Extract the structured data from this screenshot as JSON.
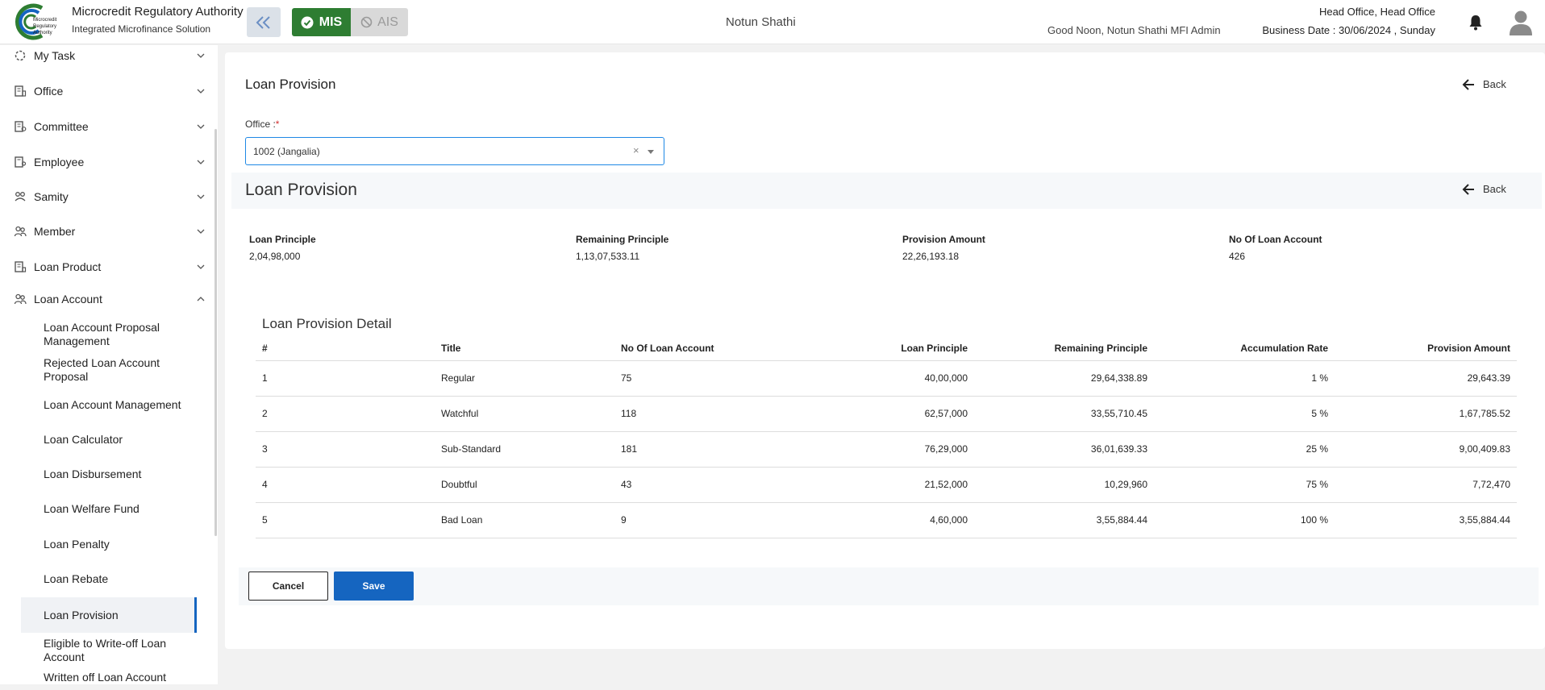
{
  "header": {
    "org_title": "Microcredit Regulatory Authority",
    "org_subtitle": "Integrated Microfinance Solution",
    "logo_text": "Microcredit Regulatory Authority",
    "mode_mis": "MIS",
    "mode_ais": "AIS",
    "brand_center": "Notun Shathi",
    "greeting": "Good Noon, Notun Shathi MFI Admin",
    "office": "Head Office, Head Office",
    "business_date": "Business Date : 30/06/2024 , Sunday",
    "accent_green": "#2e7d32",
    "accent_blue": "#1565c0"
  },
  "sidebar": {
    "items": [
      {
        "label": "My Task",
        "icon": "task-icon"
      },
      {
        "label": "Office",
        "icon": "office-icon"
      },
      {
        "label": "Committee",
        "icon": "committee-icon"
      },
      {
        "label": "Employee",
        "icon": "employee-icon"
      },
      {
        "label": "Samity",
        "icon": "samity-icon"
      },
      {
        "label": "Member",
        "icon": "member-icon"
      },
      {
        "label": "Loan Product",
        "icon": "loan-product-icon"
      },
      {
        "label": "Loan Account",
        "icon": "loan-account-icon"
      }
    ],
    "sub_items": [
      "Loan Account Proposal Management",
      "Rejected Loan Account Proposal",
      "Loan Account Management",
      "Loan Calculator",
      "Loan Disbursement",
      "Loan Welfare Fund",
      "Loan Penalty",
      "Loan Rebate",
      "Loan Provision",
      "Eligible to Write-off Loan Account",
      "Written off Loan Account"
    ]
  },
  "main": {
    "page_title": "Loan Provision",
    "back_label": "Back",
    "office_label": "Office :",
    "office_required": "*",
    "office_value": "1002 (Jangalia)",
    "clear_symbol": "×",
    "section_title": "Loan Provision",
    "summary": {
      "loan_principle_label": "Loan Principle",
      "loan_principle": "2,04,98,000",
      "remaining_principle_label": "Remaining Principle",
      "remaining_principle": "1,13,07,533.11",
      "provision_amount_label": "Provision Amount",
      "provision_amount": "22,26,193.18",
      "no_of_loan_account_label": "No Of Loan Account",
      "no_of_loan_account": "426"
    },
    "detail_title": "Loan Provision Detail",
    "columns": [
      "#",
      "Title",
      "No Of Loan Account",
      "Loan Principle",
      "Remaining Principle",
      "Accumulation Rate",
      "Provision Amount"
    ],
    "rows": [
      [
        "1",
        "Regular",
        "75",
        "40,00,000",
        "29,64,338.89",
        "1 %",
        "29,643.39"
      ],
      [
        "2",
        "Watchful",
        "118",
        "62,57,000",
        "33,55,710.45",
        "5 %",
        "1,67,785.52"
      ],
      [
        "3",
        "Sub-Standard",
        "181",
        "76,29,000",
        "36,01,639.33",
        "25 %",
        "9,00,409.83"
      ],
      [
        "4",
        "Doubtful",
        "43",
        "21,52,000",
        "10,29,960",
        "75 %",
        "7,72,470"
      ],
      [
        "5",
        "Bad Loan",
        "9",
        "4,60,000",
        "3,55,884.44",
        "100 %",
        "3,55,884.44"
      ]
    ],
    "cancel_label": "Cancel",
    "save_label": "Save"
  }
}
